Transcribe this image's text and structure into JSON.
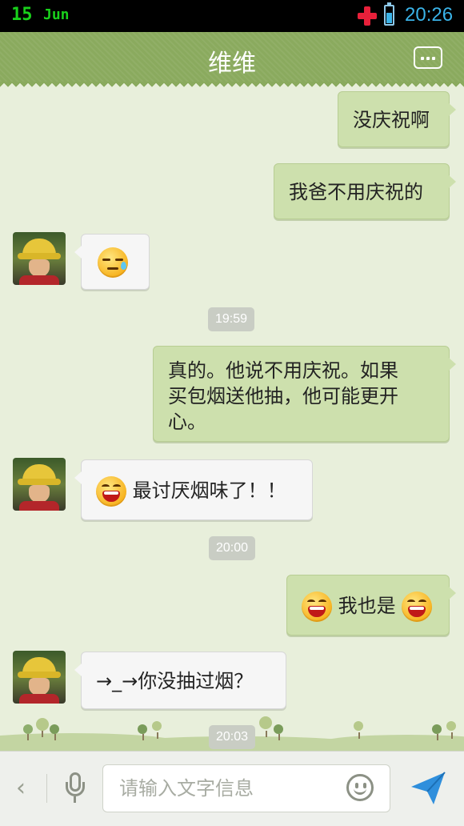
{
  "status_bar": {
    "date": "15",
    "month": "Jun",
    "time": "20:26"
  },
  "header": {
    "title": "维维",
    "menu_icon": "more-options-icon"
  },
  "messages": [
    {
      "side": "out",
      "text": "没庆祝啊"
    },
    {
      "side": "out",
      "text": "我爸不用庆祝的"
    },
    {
      "side": "in",
      "emoji": "sweat-emoji",
      "text": ""
    },
    {
      "time": "19:59"
    },
    {
      "side": "out",
      "lines": [
        "真的。他说不用庆祝。如果",
        "买包烟送他抽，他可能更开",
        "心。"
      ]
    },
    {
      "side": "in",
      "emoji": "laugh-emoji",
      "text": "最讨厌烟味了！！"
    },
    {
      "time": "20:00"
    },
    {
      "side": "out",
      "emoji": "laugh-emoji",
      "text": "我也是"
    },
    {
      "side": "in",
      "text": "→_→你没抽过烟？"
    },
    {
      "time": "20:03"
    }
  ],
  "input": {
    "placeholder": "请输入文字信息",
    "value": ""
  },
  "colors": {
    "header": "#8aaa5e",
    "outgoing_bubble": "#cde0ad",
    "incoming_bubble": "#f6f6f6",
    "background": "#e8efdb",
    "send": "#2f8fdc"
  }
}
